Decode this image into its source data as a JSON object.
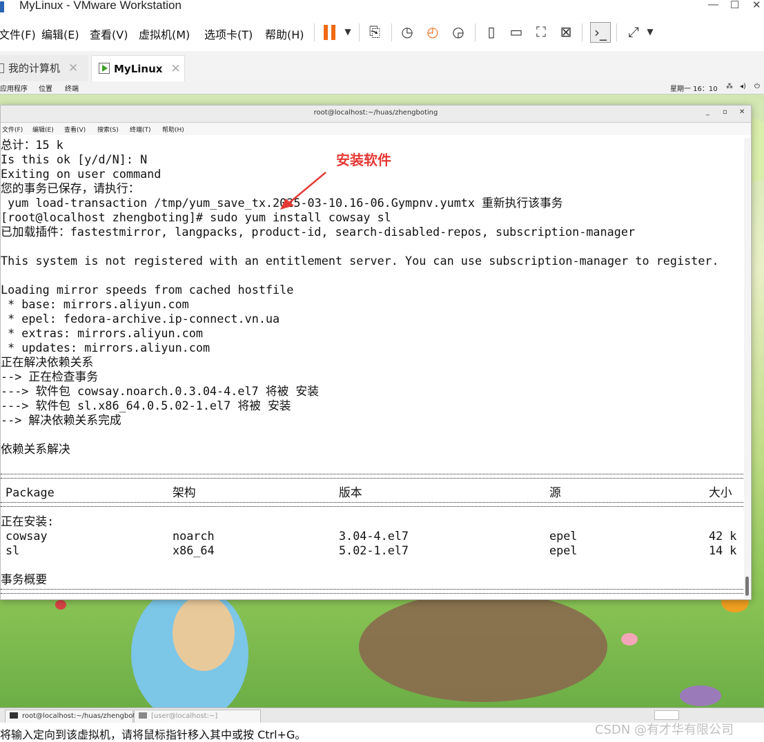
{
  "window": {
    "title": "MyLinux - VMware Workstation",
    "min": "—",
    "max": "☐",
    "close": "✕"
  },
  "menu": [
    "文件(F)",
    "编辑(E)",
    "查看(V)",
    "虚拟机(M)",
    "选项卡(T)",
    "帮助(H)"
  ],
  "tabs": [
    {
      "label": "我的计算机",
      "active": false
    },
    {
      "label": "MyLinux",
      "active": true
    }
  ],
  "gnome": {
    "apps": "应用程序",
    "places": "位置",
    "terminal": "终端",
    "clock": "星期一 16：10"
  },
  "terminal": {
    "title": "root@localhost:~/huas/zhengboting",
    "menu": [
      "文件(F)",
      "编辑(E)",
      "查看(V)",
      "搜索(S)",
      "终端(T)",
      "帮助(H)"
    ],
    "lines": [
      "总计：15 k",
      "Is this ok [y/d/N]: N",
      "Exiting on user command",
      "您的事务已保存，请执行：",
      " yum load-transaction /tmp/yum_save_tx.2025-03-10.16-06.Gympnv.yumtx 重新执行该事务",
      "[root@localhost zhengboting]# sudo yum install cowsay sl",
      "已加载插件：fastestmirror, langpacks, product-id, search-disabled-repos, subscription-manager",
      "",
      "This system is not registered with an entitlement server. You can use subscription-manager to register.",
      "",
      "Loading mirror speeds from cached hostfile",
      " * base: mirrors.aliyun.com",
      " * epel: fedora-archive.ip-connect.vn.ua",
      " * extras: mirrors.aliyun.com",
      " * updates: mirrors.aliyun.com",
      "正在解决依赖关系",
      "--> 正在检查事务",
      "---> 软件包 cowsay.noarch.0.3.04-4.el7 将被 安装",
      "---> 软件包 sl.x86_64.0.5.02-1.el7 将被 安装",
      "--> 解决依赖关系完成",
      "",
      "依赖关系解决"
    ],
    "table": {
      "headers": {
        "package": "Package",
        "arch": "架构",
        "version": "版本",
        "repo": "源",
        "size": "大小"
      },
      "section": "正在安装:",
      "rows": [
        {
          "package": "cowsay",
          "arch": "noarch",
          "version": "3.04-4.el7",
          "repo": "epel",
          "size": "42 k"
        },
        {
          "package": "sl",
          "arch": "x86_64",
          "version": "5.02-1.el7",
          "repo": "epel",
          "size": "14 k"
        }
      ],
      "summary": "事务概要"
    }
  },
  "annotation": "安装软件",
  "taskbar": [
    {
      "label": "root@localhost:~/huas/zhengboting"
    },
    {
      "label": "[user@localhost:~]"
    }
  ],
  "status": "将输入定向到该虚拟机，请将鼠标指针移入其中或按 Ctrl+G。",
  "watermark": "CSDN @有才华有限公司",
  "colors": {
    "accent_pause": "#f06a14",
    "annotation": "#e53935"
  }
}
